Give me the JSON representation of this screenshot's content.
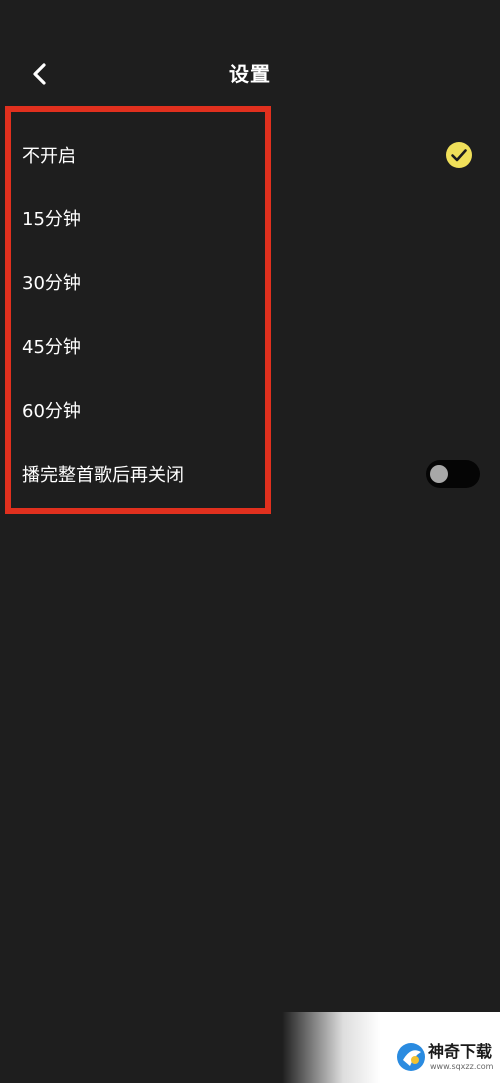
{
  "header": {
    "title": "设置",
    "back_icon": "chevron-left-icon"
  },
  "options": [
    {
      "label": "不开启",
      "selected": true
    },
    {
      "label": "15分钟",
      "selected": false
    },
    {
      "label": "30分钟",
      "selected": false
    },
    {
      "label": "45分钟",
      "selected": false
    },
    {
      "label": "60分钟",
      "selected": false
    }
  ],
  "play_to_end": {
    "label": "播完整首歌后再关闭",
    "enabled": false
  },
  "colors": {
    "background": "#1e1e1e",
    "check_accent": "#f0e05a",
    "highlight_frame": "#e0301e",
    "toggle_track": "#050505",
    "toggle_knob": "#a8a8a8"
  },
  "watermark": {
    "title": "神奇下载",
    "url": "www.sqxzz.com"
  }
}
